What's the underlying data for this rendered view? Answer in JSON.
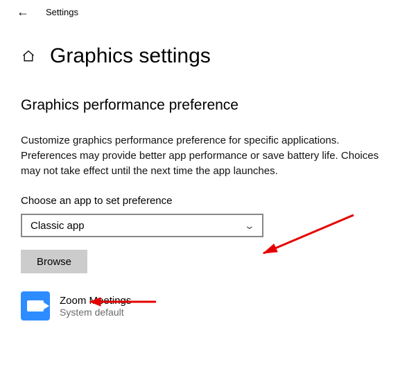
{
  "top": {
    "settings_label": "Settings"
  },
  "page": {
    "title": "Graphics settings",
    "section_title": "Graphics performance preference",
    "description": "Customize graphics performance preference for specific applications. Preferences may provide better app performance or save battery life. Choices may not take effect until the next time the app launches.",
    "choose_label": "Choose an app to set preference",
    "select_value": "Classic app",
    "browse_label": "Browse"
  },
  "apps": [
    {
      "name": "Zoom Meetings",
      "pref": "System default",
      "icon": "zoom"
    }
  ]
}
